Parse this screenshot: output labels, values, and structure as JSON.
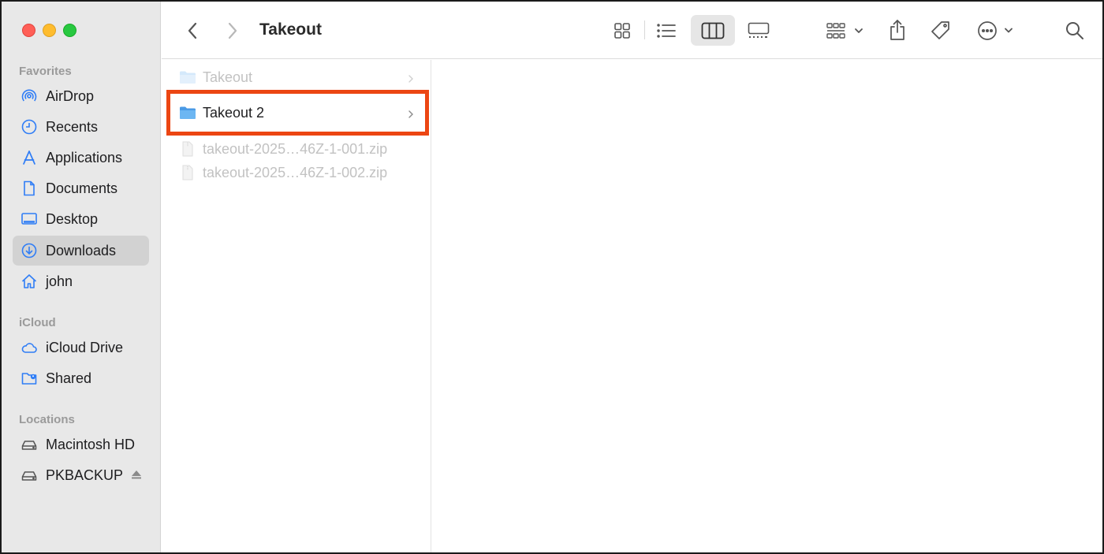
{
  "window": {
    "title": "Takeout"
  },
  "sidebar": {
    "sections": [
      {
        "title": "Favorites",
        "items": [
          {
            "label": "AirDrop",
            "icon": "airdrop-icon"
          },
          {
            "label": "Recents",
            "icon": "clock-icon"
          },
          {
            "label": "Applications",
            "icon": "applications-icon"
          },
          {
            "label": "Documents",
            "icon": "document-icon"
          },
          {
            "label": "Desktop",
            "icon": "desktop-icon"
          },
          {
            "label": "Downloads",
            "icon": "download-icon",
            "selected": true
          },
          {
            "label": "john",
            "icon": "home-icon"
          }
        ]
      },
      {
        "title": "iCloud",
        "items": [
          {
            "label": "iCloud Drive",
            "icon": "cloud-icon"
          },
          {
            "label": "Shared",
            "icon": "shared-folder-icon"
          }
        ]
      },
      {
        "title": "Locations",
        "items": [
          {
            "label": "Macintosh HD",
            "icon": "disk-icon"
          },
          {
            "label": "PKBACKUP",
            "icon": "disk-icon",
            "eject": true
          }
        ]
      }
    ]
  },
  "toolbar": {
    "active_view": "columns",
    "buttons": [
      "back-icon",
      "forward-icon",
      "icon-view-icon",
      "list-view-icon",
      "column-view-icon",
      "gallery-view-icon",
      "group-icon",
      "share-icon",
      "tag-icon",
      "more-icon",
      "search-icon"
    ]
  },
  "columns": [
    {
      "items": [
        {
          "name": "Takeout",
          "type": "folder",
          "dim": true,
          "has_children": true
        },
        {
          "name": "Takeout 2",
          "type": "folder",
          "dim": false,
          "has_children": true,
          "highlighted": true
        },
        {
          "name": "takeout-2025…46Z-1-001.zip",
          "type": "zip",
          "dim": true,
          "has_children": false
        },
        {
          "name": "takeout-2025…46Z-1-002.zip",
          "type": "zip",
          "dim": true,
          "has_children": false
        }
      ]
    }
  ],
  "colors": {
    "highlight_border": "#ec4613",
    "accent": "#2f7df6",
    "folder": "#6cb6f2"
  }
}
